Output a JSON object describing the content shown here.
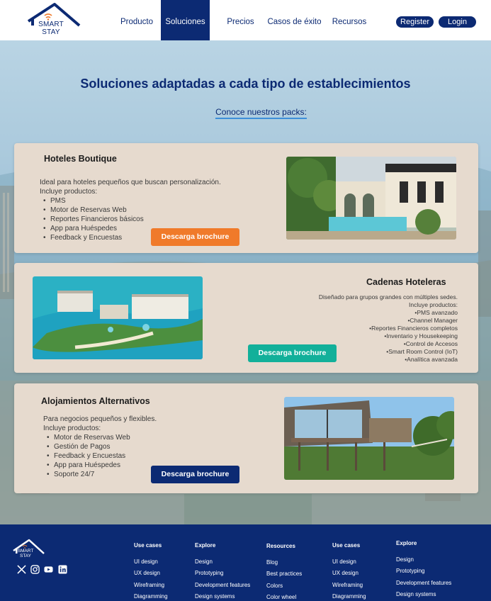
{
  "nav": {
    "logo_line1": "SMART",
    "logo_line2": "STAY",
    "links": [
      "Producto",
      "Soluciones",
      "Precios",
      "Casos de éxito",
      "Recursos"
    ],
    "active": "Soluciones",
    "register_label": "Register",
    "login_label": "Login"
  },
  "hero": {
    "title": "Soluciones adaptadas a cada tipo de establecimientos",
    "subtitle": "Conoce nuestros packs:"
  },
  "cards": [
    {
      "title": "Hoteles Boutique",
      "description": "Ideal para hoteles pequeños que buscan personalización.",
      "includes_label": "Incluye productos:",
      "products": [
        "PMS",
        "Motor de Reservas Web",
        "Reportes Financieros básicos",
        "App para Huéspedes",
        "Feedback y Encuestas"
      ],
      "button_label": "Descarga brochure",
      "button_color": "#f07a2a",
      "image": "boutique-hotel-courtyard-pool"
    },
    {
      "title": "Cadenas Hoteleras",
      "description": "Diseñado para grupos grandes con múltiples sedes.",
      "includes_label": "Incluye productos:",
      "products": [
        "PMS avanzado",
        "Channel Manager",
        "Reportes Financieros completos",
        "Inventario y Housekeeping",
        "Control de Accesos",
        "Smart Room Control (IoT)",
        "Analítica avanzada"
      ],
      "button_label": "Descarga brochure",
      "button_color": "#12b09a",
      "image": "beach-resort-aerial"
    },
    {
      "title": "Alojamientos Alternativos",
      "description": "Para negocios pequeños y flexibles.",
      "includes_label": "Incluye productos:",
      "products": [
        "Motor de Reservas Web",
        "Gestión de Pagos",
        "Feedback y Encuestas",
        "App para Huéspedes",
        "Soporte 24/7"
      ],
      "button_label": "Descarga brochure",
      "button_color": "#0c2a73",
      "image": "modern-cabin-forest"
    }
  ],
  "footer": {
    "logo_line1": "SMART",
    "logo_line2": "STAY",
    "social_icons": [
      "x-icon",
      "instagram-icon",
      "youtube-icon",
      "linkedin-icon"
    ],
    "columns": [
      {
        "heading": "Use cases",
        "items": [
          "UI design",
          "UX design",
          "Wireframing",
          "Diagramming"
        ]
      },
      {
        "heading": "Explore",
        "items": [
          "Design",
          "Prototyping",
          "Development features",
          "Design systems"
        ]
      },
      {
        "heading": "Resources",
        "items": [
          "Blog",
          "Best practices",
          "Colors",
          "Color wheel"
        ]
      },
      {
        "heading": "Use cases",
        "items": [
          "UI design",
          "UX design",
          "Wireframing",
          "Diagramming"
        ]
      },
      {
        "heading": "Explore",
        "items": [
          "Design",
          "Prototyping",
          "Development features",
          "Design systems"
        ]
      }
    ]
  },
  "colors": {
    "brand_navy": "#0c2a73",
    "card_bg": "#e6dace",
    "accent_orange": "#f07a2a",
    "accent_teal": "#12b09a",
    "link_underline": "#3d8fd9"
  }
}
